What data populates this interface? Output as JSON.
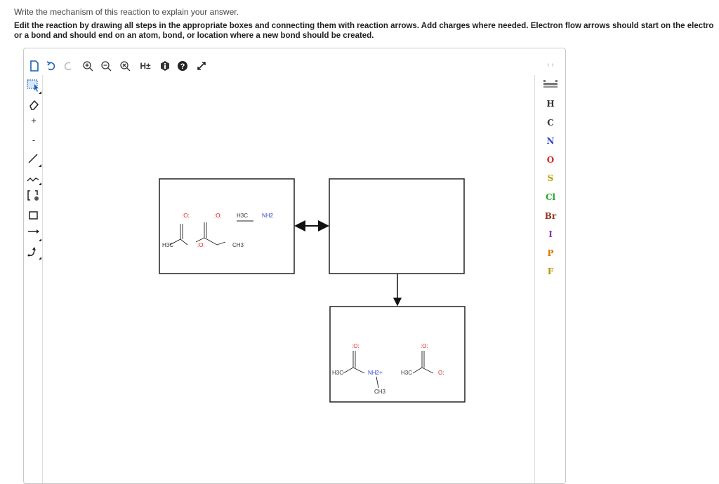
{
  "intro": "Write the mechanism of this reaction to explain your answer.",
  "instructions_line1": "Edit the reaction by drawing all steps in the appropriate boxes and connecting them with reaction arrows. Add charges where needed. Electron flow arrows should start on the electro",
  "instructions_line2": "or a bond and should end on an atom, bond, or location where a new bond should be created.",
  "toolbar": {
    "hpm_label": "H±"
  },
  "left_tools": {
    "plus": "+",
    "minus": "-"
  },
  "right_tools": {
    "nav": "‹ ›",
    "elements": [
      {
        "symbol": "H",
        "color": "#333333"
      },
      {
        "symbol": "C",
        "color": "#333333"
      },
      {
        "symbol": "N",
        "color": "#3344cc"
      },
      {
        "symbol": "O",
        "color": "#dd2222"
      },
      {
        "symbol": "S",
        "color": "#b8a000"
      },
      {
        "symbol": "Cl",
        "color": "#22aa22"
      },
      {
        "symbol": "Br",
        "color": "#993322"
      },
      {
        "symbol": "I",
        "color": "#8833aa"
      },
      {
        "symbol": "P",
        "color": "#dd7700"
      },
      {
        "symbol": "F",
        "color": "#b89a00"
      }
    ]
  },
  "reactants": {
    "o1": ":O:",
    "o2": ":O:",
    "h3c": "H3C",
    "o_bridge": ":O:",
    "ch3": "CH3",
    "methylamine_c": "H3C",
    "methylamine_n": "NH2"
  },
  "products": {
    "o_amide": ":O:",
    "h3c_amide": "H3C",
    "nh2_plus": "NH2+",
    "ch3_n": "CH3",
    "o_acid_top": ":O:",
    "h3c_acid": "H3C",
    "o_acid_minus": "O:"
  }
}
